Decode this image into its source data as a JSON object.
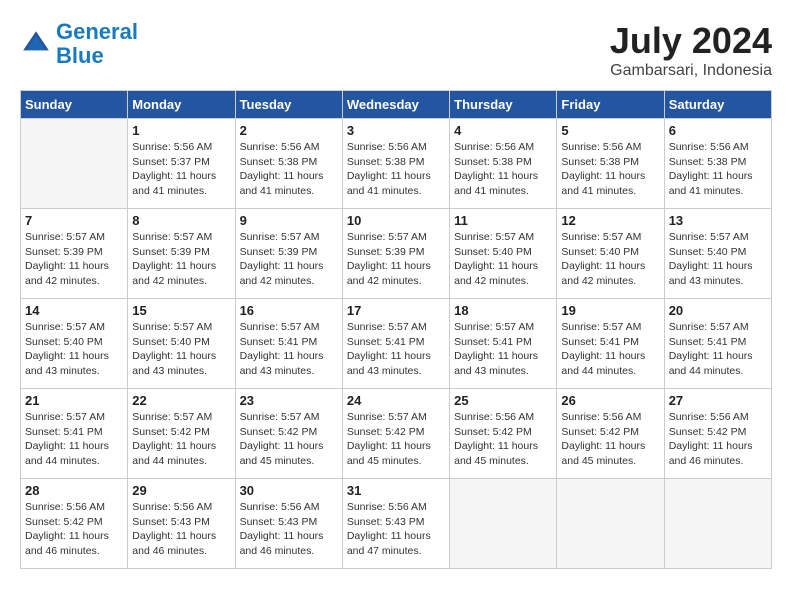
{
  "header": {
    "logo_line1": "General",
    "logo_line2": "Blue",
    "month_year": "July 2024",
    "location": "Gambarsari, Indonesia"
  },
  "weekdays": [
    "Sunday",
    "Monday",
    "Tuesday",
    "Wednesday",
    "Thursday",
    "Friday",
    "Saturday"
  ],
  "weeks": [
    [
      {
        "day": "",
        "info": ""
      },
      {
        "day": "1",
        "info": "Sunrise: 5:56 AM\nSunset: 5:37 PM\nDaylight: 11 hours\nand 41 minutes."
      },
      {
        "day": "2",
        "info": "Sunrise: 5:56 AM\nSunset: 5:38 PM\nDaylight: 11 hours\nand 41 minutes."
      },
      {
        "day": "3",
        "info": "Sunrise: 5:56 AM\nSunset: 5:38 PM\nDaylight: 11 hours\nand 41 minutes."
      },
      {
        "day": "4",
        "info": "Sunrise: 5:56 AM\nSunset: 5:38 PM\nDaylight: 11 hours\nand 41 minutes."
      },
      {
        "day": "5",
        "info": "Sunrise: 5:56 AM\nSunset: 5:38 PM\nDaylight: 11 hours\nand 41 minutes."
      },
      {
        "day": "6",
        "info": "Sunrise: 5:56 AM\nSunset: 5:38 PM\nDaylight: 11 hours\nand 41 minutes."
      }
    ],
    [
      {
        "day": "7",
        "info": "Sunrise: 5:57 AM\nSunset: 5:39 PM\nDaylight: 11 hours\nand 42 minutes."
      },
      {
        "day": "8",
        "info": "Sunrise: 5:57 AM\nSunset: 5:39 PM\nDaylight: 11 hours\nand 42 minutes."
      },
      {
        "day": "9",
        "info": "Sunrise: 5:57 AM\nSunset: 5:39 PM\nDaylight: 11 hours\nand 42 minutes."
      },
      {
        "day": "10",
        "info": "Sunrise: 5:57 AM\nSunset: 5:39 PM\nDaylight: 11 hours\nand 42 minutes."
      },
      {
        "day": "11",
        "info": "Sunrise: 5:57 AM\nSunset: 5:40 PM\nDaylight: 11 hours\nand 42 minutes."
      },
      {
        "day": "12",
        "info": "Sunrise: 5:57 AM\nSunset: 5:40 PM\nDaylight: 11 hours\nand 42 minutes."
      },
      {
        "day": "13",
        "info": "Sunrise: 5:57 AM\nSunset: 5:40 PM\nDaylight: 11 hours\nand 43 minutes."
      }
    ],
    [
      {
        "day": "14",
        "info": "Sunrise: 5:57 AM\nSunset: 5:40 PM\nDaylight: 11 hours\nand 43 minutes."
      },
      {
        "day": "15",
        "info": "Sunrise: 5:57 AM\nSunset: 5:40 PM\nDaylight: 11 hours\nand 43 minutes."
      },
      {
        "day": "16",
        "info": "Sunrise: 5:57 AM\nSunset: 5:41 PM\nDaylight: 11 hours\nand 43 minutes."
      },
      {
        "day": "17",
        "info": "Sunrise: 5:57 AM\nSunset: 5:41 PM\nDaylight: 11 hours\nand 43 minutes."
      },
      {
        "day": "18",
        "info": "Sunrise: 5:57 AM\nSunset: 5:41 PM\nDaylight: 11 hours\nand 43 minutes."
      },
      {
        "day": "19",
        "info": "Sunrise: 5:57 AM\nSunset: 5:41 PM\nDaylight: 11 hours\nand 44 minutes."
      },
      {
        "day": "20",
        "info": "Sunrise: 5:57 AM\nSunset: 5:41 PM\nDaylight: 11 hours\nand 44 minutes."
      }
    ],
    [
      {
        "day": "21",
        "info": "Sunrise: 5:57 AM\nSunset: 5:41 PM\nDaylight: 11 hours\nand 44 minutes."
      },
      {
        "day": "22",
        "info": "Sunrise: 5:57 AM\nSunset: 5:42 PM\nDaylight: 11 hours\nand 44 minutes."
      },
      {
        "day": "23",
        "info": "Sunrise: 5:57 AM\nSunset: 5:42 PM\nDaylight: 11 hours\nand 45 minutes."
      },
      {
        "day": "24",
        "info": "Sunrise: 5:57 AM\nSunset: 5:42 PM\nDaylight: 11 hours\nand 45 minutes."
      },
      {
        "day": "25",
        "info": "Sunrise: 5:56 AM\nSunset: 5:42 PM\nDaylight: 11 hours\nand 45 minutes."
      },
      {
        "day": "26",
        "info": "Sunrise: 5:56 AM\nSunset: 5:42 PM\nDaylight: 11 hours\nand 45 minutes."
      },
      {
        "day": "27",
        "info": "Sunrise: 5:56 AM\nSunset: 5:42 PM\nDaylight: 11 hours\nand 46 minutes."
      }
    ],
    [
      {
        "day": "28",
        "info": "Sunrise: 5:56 AM\nSunset: 5:42 PM\nDaylight: 11 hours\nand 46 minutes."
      },
      {
        "day": "29",
        "info": "Sunrise: 5:56 AM\nSunset: 5:43 PM\nDaylight: 11 hours\nand 46 minutes."
      },
      {
        "day": "30",
        "info": "Sunrise: 5:56 AM\nSunset: 5:43 PM\nDaylight: 11 hours\nand 46 minutes."
      },
      {
        "day": "31",
        "info": "Sunrise: 5:56 AM\nSunset: 5:43 PM\nDaylight: 11 hours\nand 47 minutes."
      },
      {
        "day": "",
        "info": ""
      },
      {
        "day": "",
        "info": ""
      },
      {
        "day": "",
        "info": ""
      }
    ]
  ]
}
